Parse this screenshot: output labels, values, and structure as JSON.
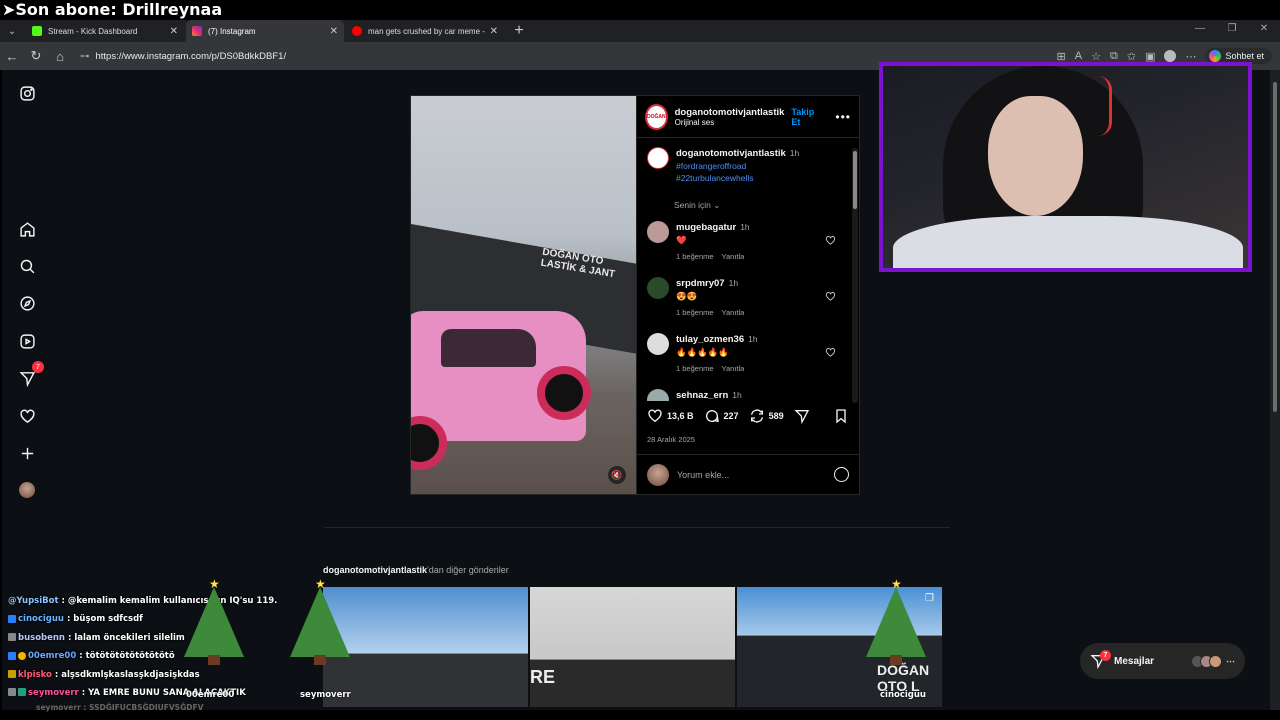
{
  "stream_banner": "➤Son abone: Drillreynaa",
  "browser": {
    "tabs": [
      {
        "label": "Stream - Kick Dashboard",
        "color": "#53fc18",
        "active": false
      },
      {
        "label": "(7) Instagram",
        "color": "#d6249f",
        "active": true
      },
      {
        "label": "man gets crushed by car meme - Y",
        "color": "#ff0000",
        "active": false
      }
    ],
    "url": "https://www.instagram.com/p/DS0BdkkDBF1/",
    "copilot_label": "Sohbet et"
  },
  "sidebar": {
    "icons": [
      "instagram-icon",
      "home-icon",
      "search-icon",
      "explore-icon",
      "reels-icon",
      "messages-icon",
      "notifications-icon",
      "create-icon",
      "profile-icon"
    ],
    "messages_badge": "7"
  },
  "post": {
    "header": {
      "username": "doganotomotivjantlastik",
      "audio": "Orijinal ses",
      "follow_label": "Takip Et",
      "avatar_text": "DOĞAN"
    },
    "caption": {
      "username": "doganotomotivjantlastik",
      "time": "1h",
      "tags": [
        "#fordrangeroffroad",
        "#22turbulancewhells"
      ]
    },
    "for_you_label": "Senin için",
    "media_sign": "DOĞAN OTO LASTİK & JANT",
    "comments": [
      {
        "username": "mugebagatur",
        "time": "1h",
        "text": "❤️",
        "likes": "1 beğenme",
        "reply": "Yanıtla"
      },
      {
        "username": "srpdmry07",
        "time": "1h",
        "text": "😍😍",
        "likes": "1 beğenme",
        "reply": "Yanıtla"
      },
      {
        "username": "tulay_ozmen36",
        "time": "1h",
        "text": "🔥🔥🔥🔥🔥",
        "likes": "1 beğenme",
        "reply": "Yanıtla"
      },
      {
        "username": "sehnaz_ern",
        "time": "1h",
        "text": "",
        "likes": "",
        "reply": ""
      }
    ],
    "stats": {
      "likes": "13,6 B",
      "comments": "227",
      "reposts": "589"
    },
    "date": "28 Aralık 2025",
    "add_comment_placeholder": "Yorum ekle..."
  },
  "more_posts": {
    "username": "doganotomotivjantlastik",
    "suffix": "'dan diğer gönderiler"
  },
  "messages_pill": {
    "label": "Mesajlar",
    "badge": "7"
  },
  "chat": [
    {
      "user": "@YupsiBot",
      "color": "#8ec5ff",
      "message": ": @kemalim kemalim kullanıcısının IQ'su 119."
    },
    {
      "user": "cinociguu",
      "color": "#6fb4ff",
      "message": ": büşom sdfcsdf"
    },
    {
      "user": "busobenn",
      "color": "#b9c6ff",
      "message": ": lalam öncekileri silelim"
    },
    {
      "user": "00emre00",
      "color": "#6aa8ff",
      "message": ": tötötötötötötötötö"
    },
    {
      "user": "klpisko",
      "color": "#ff5a7a",
      "message": ": alşsdkmlşkaslasşkdjasişkdas"
    },
    {
      "user": "seymoverr",
      "color": "#ff4fa0",
      "message": ": YA EMRE BUNU SANA ALACAKTIK"
    }
  ],
  "chat_faded": "seymoverr : SSDĞIFUCBSĞDIUFVSĞDFV",
  "tree_labels": [
    "00emre00",
    "seymoverr",
    "cinociguu"
  ]
}
